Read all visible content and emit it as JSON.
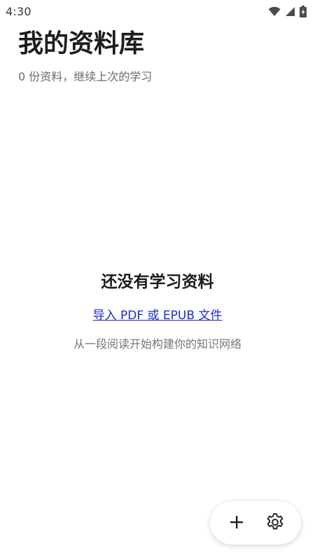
{
  "status_bar": {
    "time": "4:30",
    "icons": [
      "wifi-icon",
      "cellular-signal-icon",
      "battery-charging-icon"
    ]
  },
  "header": {
    "title": "我的资料库",
    "subtitle": "0 份资料，继续上次的学习"
  },
  "empty_state": {
    "title": "还没有学习资料",
    "import_link": "导入 PDF 或 EPUB 文件",
    "hint": "从一段阅读开始构建你的知识网络"
  },
  "fab": {
    "buttons": [
      "add-icon",
      "gear-icon"
    ]
  },
  "colors": {
    "background": "#ffffff",
    "title_text": "#1d1d1d",
    "secondary_text": "#6b6b6b",
    "link": "#1a2bd1"
  }
}
